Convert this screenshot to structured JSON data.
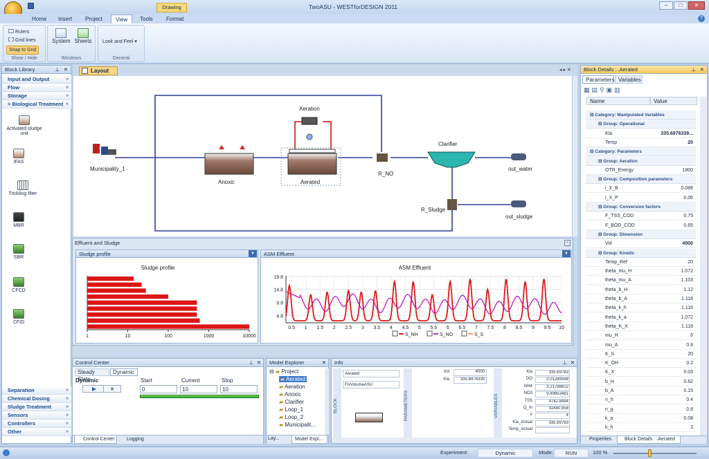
{
  "app": {
    "title": "TwoASU - WESTforDESIGN 2011",
    "context_tab": "Drawing"
  },
  "tabs": [
    {
      "label": "Home"
    },
    {
      "label": "Insert"
    },
    {
      "label": "Project"
    },
    {
      "label": "View"
    },
    {
      "label": "Tools"
    },
    {
      "label": "Format"
    }
  ],
  "ribbon": {
    "rulers": "Rulers",
    "grid_lines": "Grid lines",
    "snap": "Snap to Grid",
    "show_hide": "Show / Hide",
    "system": "System",
    "sheets": "Sheets",
    "windows": "Windows",
    "look_feel": "Look and Feel",
    "general": "General"
  },
  "block_library": {
    "title": "Block Library",
    "categories_top": [
      "Input and Output",
      "Flow",
      "Storage",
      "> Biological Treatment"
    ],
    "items": [
      "Activated sludge unit",
      "IFAS",
      "Trickling filter",
      "MBR",
      "SBR",
      "CFCD",
      "CFID"
    ],
    "categories_bottom": [
      "Separation",
      "Chemical Dosing",
      "Sludge Treatment",
      "Sensors",
      "Controllers",
      "Other"
    ]
  },
  "layout": {
    "tab": "Layout",
    "labels": {
      "aeration": "Aeration",
      "clarifier": "Clarifier",
      "municipality": "Municipality_1",
      "anoxic": "Anoxic",
      "aerated": "Aerated",
      "r_no": "R_NO",
      "out_water": "out_water",
      "r_sludge": "R_Sludge",
      "out_sludge": "out_sludge"
    }
  },
  "effluent": {
    "title": "Effluent and Sludge",
    "sludge_tab": "Sludge profile",
    "asm_tab": "ASM Effluent"
  },
  "chart_data": [
    {
      "type": "bar",
      "title": "Sludge profile",
      "orientation": "horizontal",
      "xscale": "log",
      "xlim": [
        1,
        10000
      ],
      "xticks": [
        "1",
        "10",
        "100",
        "1000",
        "10000"
      ],
      "values": [
        14,
        22,
        28,
        100,
        510,
        510,
        510,
        600,
        10000
      ]
    },
    {
      "type": "line",
      "title": "ASM Effluent",
      "xlim": [
        0.3,
        10
      ],
      "ylim": [
        2,
        20
      ],
      "yticks": [
        "19.8",
        "14.8",
        "9.8",
        "4.8"
      ],
      "xticks": [
        "0.5",
        "1",
        "1.5",
        "2",
        "2.5",
        "3",
        "3.5",
        "4",
        "4.5",
        "5",
        "5.5",
        "6",
        "6.5",
        "7",
        "7.5",
        "8",
        "8.5",
        "9",
        "9.5",
        "10"
      ],
      "series": [
        {
          "name": "S_NH",
          "color": "#e01818"
        },
        {
          "name": "S_NO",
          "color": "#c028c8"
        },
        {
          "name": "S_S",
          "color": "#f0a060"
        }
      ]
    }
  ],
  "control_center": {
    "title": "Control Center",
    "tab_steady": "Steady State",
    "tab_dynamic": "Dynamic",
    "dynamic": "Dynamic",
    "start_label": "Start",
    "current_label": "Current",
    "stop_label": "Stop",
    "start": "0",
    "current": "10",
    "stop": "10"
  },
  "model_explorer": {
    "title": "Model Explorer",
    "items": [
      "Project",
      "Aerated",
      "Aeration",
      "Anoxic",
      "Clarifier",
      "Loop_1",
      "Loop_2",
      "Municipalit..."
    ]
  },
  "info": {
    "title": "Info",
    "block_label": "BLOCK",
    "params_label": "PARAMETERS",
    "vars_label": "VARIABLES",
    "block_name": "Aerated",
    "block_model": "FixVolumeASU",
    "params": [
      {
        "n": "Vol",
        "v": "4000"
      },
      {
        "n": "Kla",
        "v": "335.6976339"
      }
    ],
    "vars": [
      {
        "n": "Kla",
        "v": "335.69763"
      },
      {
        "n": "DO",
        "v": "2.01289568"
      },
      {
        "n": "NH4",
        "v": "3.21798812"
      },
      {
        "n": "NO3",
        "v": "9.49853481"
      },
      {
        "n": "TSS",
        "v": "4742.8494"
      },
      {
        "n": "Q_In",
        "v": "92480.958"
      },
      {
        "n": "V",
        "v": "4"
      },
      {
        "n": "Kla_Actual",
        "v": "335.69763"
      },
      {
        "n": "Temp_Actual",
        "v": ""
      }
    ]
  },
  "bottom_tabs": {
    "control": "Control Center",
    "logging": "Logging",
    "lay": "Lay...",
    "model": "Model Expl..."
  },
  "block_details": {
    "title": "Block Details : .Aerated",
    "tab_params": "Parameters",
    "tab_vars": "Variables",
    "col_name": "Name",
    "col_value": "Value",
    "rows": [
      {
        "t": "c",
        "n": "Category: Manipulated Variables"
      },
      {
        "t": "g",
        "n": "Group: Operational"
      },
      {
        "t": "r",
        "n": "Kla",
        "v": "335.6976339..."
      },
      {
        "t": "r",
        "n": "Temp",
        "v": "20"
      },
      {
        "t": "c",
        "n": "Category: Parameters"
      },
      {
        "t": "g",
        "n": "Group: Aeration"
      },
      {
        "t": "r",
        "n": "OTR_Energy",
        "v": "1800"
      },
      {
        "t": "g",
        "n": "Group: Composition parameters"
      },
      {
        "t": "r",
        "n": "i_X_B",
        "v": "0.086"
      },
      {
        "t": "r",
        "n": "i_X_P",
        "v": "0.06"
      },
      {
        "t": "g",
        "n": "Group: Conversion factors"
      },
      {
        "t": "r",
        "n": "F_TSS_COD",
        "v": "0.75"
      },
      {
        "t": "r",
        "n": "F_BOD_COD",
        "v": "0.65"
      },
      {
        "t": "g",
        "n": "Group: Dimension"
      },
      {
        "t": "r",
        "n": "Vol",
        "v": "4000"
      },
      {
        "t": "g",
        "n": "Group: Kinetic"
      },
      {
        "t": "r",
        "n": "Temp_Ref",
        "v": "20"
      },
      {
        "t": "r",
        "n": "theta_mu_H",
        "v": "1.072"
      },
      {
        "t": "r",
        "n": "theta_mu_A",
        "v": "1.103"
      },
      {
        "t": "r",
        "n": "theta_b_H",
        "v": "1.12"
      },
      {
        "t": "r",
        "n": "theta_b_A",
        "v": "1.116"
      },
      {
        "t": "r",
        "n": "theta_k_h",
        "v": "1.116"
      },
      {
        "t": "r",
        "n": "theta_k_a",
        "v": "1.072"
      },
      {
        "t": "r",
        "n": "theta_K_X",
        "v": "1.116"
      },
      {
        "t": "r",
        "n": "mu_H",
        "v": "6"
      },
      {
        "t": "r",
        "n": "mu_A",
        "v": "0.8"
      },
      {
        "t": "r",
        "n": "K_S",
        "v": "20"
      },
      {
        "t": "r",
        "n": "K_OH",
        "v": "0.2"
      },
      {
        "t": "r",
        "n": "K_X",
        "v": "0.03"
      },
      {
        "t": "r",
        "n": "b_H",
        "v": "0.62"
      },
      {
        "t": "r",
        "n": "b_A",
        "v": "0.15"
      },
      {
        "t": "r",
        "n": "n_h",
        "v": "0.4"
      },
      {
        "t": "r",
        "n": "n_g",
        "v": "0.8"
      },
      {
        "t": "r",
        "n": "k_a",
        "v": "0.08"
      },
      {
        "t": "r",
        "n": "k_h",
        "v": "3"
      }
    ],
    "tab_properties": "Properties",
    "tab_details": "Block Details : .Aerated"
  },
  "status": {
    "experiment_label": "Experiment:",
    "experiment": "Dynamic",
    "mode_label": "Mode:",
    "mode": "RUN",
    "zoom": "100 %"
  }
}
